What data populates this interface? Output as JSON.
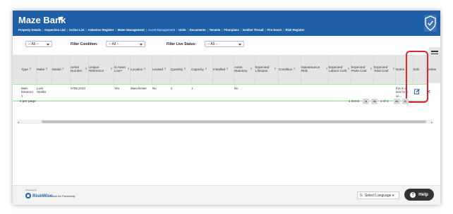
{
  "header": {
    "brand": "Maze Bank",
    "nav": [
      "Property Details",
      "Inspection List",
      "Action List",
      "Asbestos Register",
      "Water Management",
      "Asset Management",
      "Units",
      "Documents",
      "Tenants",
      "Floorplans",
      "Golden Thread",
      "Fire Doors",
      "Risk Register"
    ],
    "active_nav": "Asset Management"
  },
  "filters": {
    "first_select": "-- All --",
    "condition_label": "Filter Condition:",
    "condition_select": "-- All --",
    "live_status_label": "Filter Live Status:",
    "live_status_select": "-- All --"
  },
  "table": {
    "columns": [
      "Type",
      "Make",
      "Model",
      "Serial Number",
      "Unique Reference",
      "Is Asset Live?",
      "Location",
      "Leased",
      "Quantity",
      "Capacity",
      "Installed",
      "Asset Statutory",
      "Expected Lifespan",
      "Condition",
      "Maintenance Risk",
      "Expected Labour Cost",
      "Expected Parts Cost",
      "Expected Total Cost",
      "Notes",
      "Edit",
      "Delete"
    ],
    "row": {
      "type": "Main Entrance 1",
      "make": "Lock Smiths",
      "serial": "0708 2443",
      "live": "Yes",
      "location": "Manchester",
      "leased": "No",
      "quantity": "2",
      "capacity": "1",
      "statutory": "No",
      "notes": "this is a test for a ve..."
    }
  },
  "pagination": {
    "per_page": "s per page",
    "items": "1 Items",
    "page": "1 of 1"
  },
  "footer": {
    "powered": "Powered by",
    "logo": "RiskWise",
    "partner": "from the       Partnership",
    "language": "Select Language",
    "help": "Help"
  },
  "colors": {
    "header": "#1f5fa8",
    "highlight": "#e0232a",
    "row_border": "#8fd68f"
  }
}
